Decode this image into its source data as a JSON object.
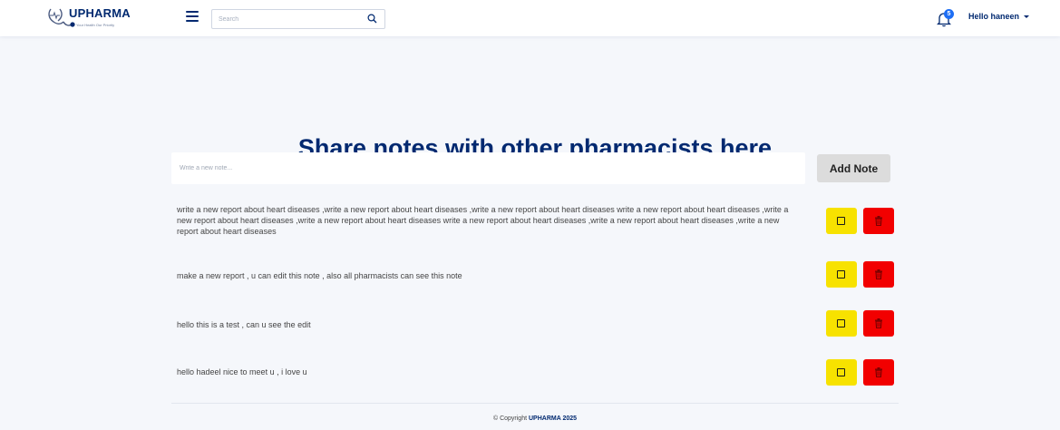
{
  "brand": {
    "name": "UPHARMA",
    "tagline": "Your Health Our Priority"
  },
  "header": {
    "search_placeholder": "Search",
    "notification_count": "5",
    "user_greeting": "Hello haneen"
  },
  "main": {
    "title": "Share notes with other pharmacists here",
    "note_placeholder": "Write a new note...",
    "add_button": "Add Note",
    "notes": [
      {
        "text": "write a new report about heart diseases ,write a new report about heart diseases ,write a new report about heart diseases write a new report about heart diseases ,write a new report about heart diseases ,write a new report about heart diseases write a new report about heart diseases ,write a new report about heart diseases ,write a new report about heart diseases"
      },
      {
        "text": "make a new report , u can edit this note , also all pharmacists can see this note"
      },
      {
        "text": "hello this is a test , can u see the edit"
      },
      {
        "text": "hello hadeel nice to meet u , i love u"
      }
    ]
  },
  "footer": {
    "prefix": "© Copyright",
    "brand": "UPHARMA 2025"
  },
  "colors": {
    "brand": "#012970",
    "edit_button": "#f7e200",
    "delete_button": "#f20000",
    "badge": "#1e6ef4"
  }
}
